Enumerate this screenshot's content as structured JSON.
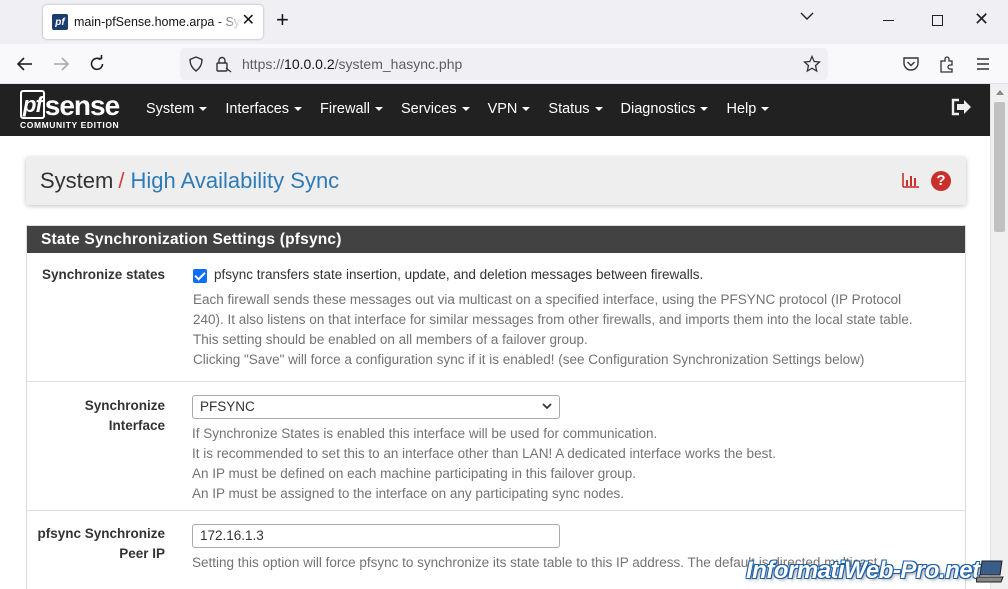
{
  "browser": {
    "tab_title": "main-pfSense.home.arpa - System: High Availability Sync",
    "favicon": "pf",
    "url_proto": "https://",
    "url_host": "10.0.0.2",
    "url_path": "/system_hasync.php"
  },
  "logo": {
    "pf": "pf",
    "sense": "sense",
    "edition": "COMMUNITY EDITION"
  },
  "menu": [
    "System",
    "Interfaces",
    "Firewall",
    "Services",
    "VPN",
    "Status",
    "Diagnostics",
    "Help"
  ],
  "breadcrumb": {
    "section": "System",
    "separator": "/",
    "page": "High Availability Sync"
  },
  "panel": {
    "title": "State Synchronization Settings (pfsync)"
  },
  "fields": {
    "sync_states": {
      "label": "Synchronize states",
      "checked": true,
      "checkbox_text": "pfsync transfers state insertion, update, and deletion messages between firewalls.",
      "help": [
        "Each firewall sends these messages out via multicast on a specified interface, using the PFSYNC protocol (IP Protocol",
        "240). It also listens on that interface for similar messages from other firewalls, and imports them into the local state table.",
        "This setting should be enabled on all members of a failover group.",
        "Clicking \"Save\" will force a configuration sync if it is enabled! (see Configuration Synchronization Settings below)"
      ]
    },
    "sync_interface": {
      "label_line1": "Synchronize",
      "label_line2": "Interface",
      "value": "PFSYNC",
      "help": [
        "If Synchronize States is enabled this interface will be used for communication.",
        "It is recommended to set this to an interface other than LAN! A dedicated interface works the best.",
        "An IP must be defined on each machine participating in this failover group.",
        "An IP must be assigned to the interface on any participating sync nodes."
      ]
    },
    "peer_ip": {
      "label_line1": "pfsync Synchronize",
      "label_line2": "Peer IP",
      "value": "172.16.1.3",
      "help": "Setting this option will force pfsync to synchronize its state table to this IP address. The default is directed multicast."
    }
  },
  "watermark": "InformatiWeb-Pro.net",
  "colors": {
    "nav_bg": "#212121",
    "panel_heading": "#424242",
    "breadcrumb_link": "#2e7bb8",
    "breadcrumb_sep": "#d43f3a",
    "help_icon": "#c9302c",
    "checkbox": "#0d6efd"
  }
}
